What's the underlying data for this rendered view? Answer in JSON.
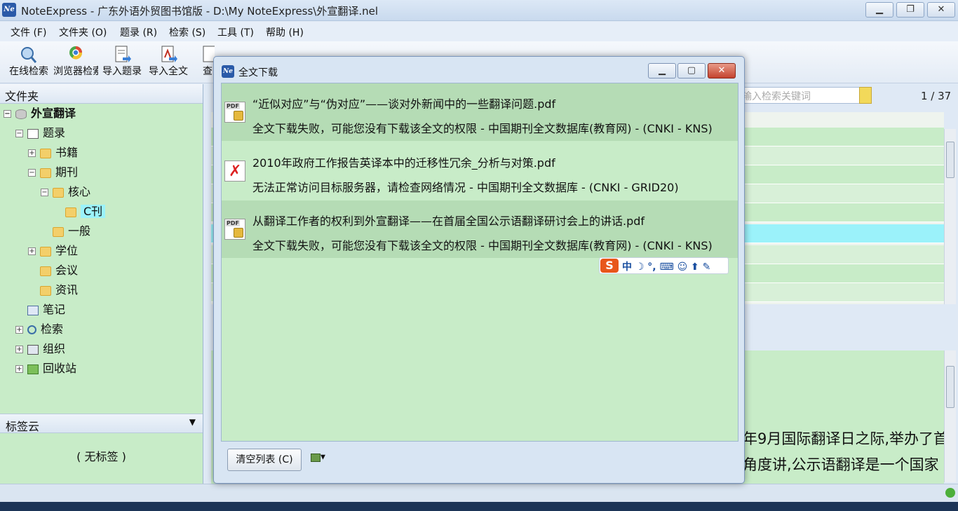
{
  "window": {
    "title": "NoteExpress - 广东外语外贸图书馆版 - D:\\My NoteExpress\\外宣翻译.nel",
    "logo_text": "Ne"
  },
  "menu": [
    "文件 (F)",
    "文件夹 (O)",
    "题录 (R)",
    "检索 (S)",
    "工具 (T)",
    "帮助 (H)"
  ],
  "toolbar": {
    "buttons": [
      {
        "label": "在线检索",
        "icon": "online-search-icon"
      },
      {
        "label": "浏览器检索",
        "icon": "browser-search-icon"
      },
      {
        "label": "导入题录",
        "icon": "import-records-icon"
      },
      {
        "label": "导入全文",
        "icon": "import-fulltext-icon"
      },
      {
        "label": "查",
        "icon": "find-icon"
      }
    ]
  },
  "left_panel": {
    "header": "文件夹",
    "tree": [
      {
        "label": "外宣翻译",
        "level": 0,
        "expander": "−",
        "icon": "database-icon",
        "bold": true
      },
      {
        "label": "题录",
        "level": 1,
        "expander": "−",
        "icon": "records-icon"
      },
      {
        "label": "书籍",
        "level": 2,
        "expander": "+",
        "icon": "folder-icon"
      },
      {
        "label": "期刊",
        "level": 2,
        "expander": "−",
        "icon": "folder-icon"
      },
      {
        "label": "核心",
        "level": 3,
        "expander": "−",
        "icon": "folder-icon"
      },
      {
        "label": "C刊",
        "level": 4,
        "expander": "",
        "icon": "folder-icon",
        "selected": true
      },
      {
        "label": "一般",
        "level": 3,
        "expander": "",
        "icon": "folder-icon"
      },
      {
        "label": "学位",
        "level": 2,
        "expander": "+",
        "icon": "folder-icon"
      },
      {
        "label": "会议",
        "level": 2,
        "expander": "",
        "icon": "folder-icon"
      },
      {
        "label": "资讯",
        "level": 2,
        "expander": "",
        "icon": "folder-icon"
      },
      {
        "label": "笔记",
        "level": 1,
        "expander": "",
        "icon": "notes-icon"
      },
      {
        "label": "检索",
        "level": 1,
        "expander": "+",
        "icon": "search-icon"
      },
      {
        "label": "组织",
        "level": 1,
        "expander": "+",
        "icon": "organize-icon"
      },
      {
        "label": "回收站",
        "level": 1,
        "expander": "+",
        "icon": "recycle-bin-icon"
      }
    ],
    "tags_header": "标签云",
    "tags_empty": "( 无标签 )"
  },
  "main": {
    "search_placeholder": "输入检索关键词",
    "page_count": "1 / 37",
    "preview_lines": [
      "年9月国际翻译日之际,举办了首",
      "角度讲,公示语翻译是一个国家"
    ]
  },
  "dialog": {
    "title": "全文下载",
    "logo_text": "Ne",
    "items": [
      {
        "name": "“近似对应”与“伪对应”——谈对外新闻中的一些翻译问题.pdf",
        "status": "全文下载失败，可能您没有下载该全文的权限  -  中国期刊全文数据库(教育网) - (CNKI - KNS)",
        "icon": "pdf-locked-icon"
      },
      {
        "name": "2010年政府工作报告英译本中的迁移性冗余_分析与对策.pdf",
        "status": "无法正常访问目标服务器，请检查网络情况  -  中国期刊全文数据库 - (CNKI - GRID20)",
        "icon": "download-failed-icon"
      },
      {
        "name": "从翻译工作者的权利到外宣翻译——在首届全国公示语翻译研讨会上的讲话.pdf",
        "status": "全文下载失败，可能您没有下载该全文的权限  -  中国期刊全文数据库(教育网) - (CNKI - KNS)",
        "icon": "pdf-locked-icon"
      }
    ],
    "ime": {
      "logo": "S",
      "text": "中 ☽ °, ⌨ ☺ ⬆ ✎"
    },
    "clear_button": "清空列表 (C)",
    "options_icon": "options-icon"
  },
  "colors": {
    "panel_green": "#c8ecc8",
    "selected_cyan": "#9bf2fa",
    "close_red": "#c4422e"
  }
}
